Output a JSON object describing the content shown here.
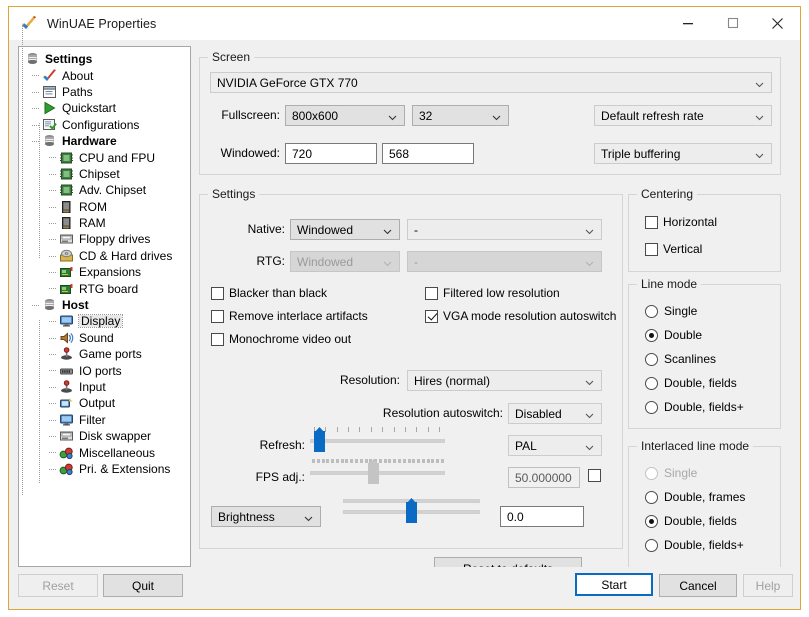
{
  "window": {
    "title": "WinUAE Properties",
    "icon": "checkmark-icon",
    "minimize": "─",
    "maximize": "□",
    "close": "✕",
    "accent_border": "#e0a53a"
  },
  "sidebar": {
    "items": [
      {
        "label": "Settings",
        "level": 0,
        "bold": true,
        "icon": "settings-icon",
        "selected": false
      },
      {
        "label": "About",
        "level": 1,
        "bold": false,
        "icon": "about-icon",
        "selected": false
      },
      {
        "label": "Paths",
        "level": 1,
        "bold": false,
        "icon": "paths-icon",
        "selected": false
      },
      {
        "label": "Quickstart",
        "level": 1,
        "bold": false,
        "icon": "quickstart-icon",
        "selected": false
      },
      {
        "label": "Configurations",
        "level": 1,
        "bold": false,
        "icon": "configurations-icon",
        "selected": false
      },
      {
        "label": "Hardware",
        "level": 1,
        "bold": true,
        "icon": "hardware-icon",
        "selected": false
      },
      {
        "label": "CPU and FPU",
        "level": 2,
        "bold": false,
        "icon": "cpu-icon",
        "selected": false
      },
      {
        "label": "Chipset",
        "level": 2,
        "bold": false,
        "icon": "chipset-icon",
        "selected": false
      },
      {
        "label": "Adv. Chipset",
        "level": 2,
        "bold": false,
        "icon": "adv-chipset-icon",
        "selected": false
      },
      {
        "label": "ROM",
        "level": 2,
        "bold": false,
        "icon": "rom-icon",
        "selected": false
      },
      {
        "label": "RAM",
        "level": 2,
        "bold": false,
        "icon": "ram-icon",
        "selected": false
      },
      {
        "label": "Floppy drives",
        "level": 2,
        "bold": false,
        "icon": "floppy-icon",
        "selected": false
      },
      {
        "label": "CD & Hard drives",
        "level": 2,
        "bold": false,
        "icon": "cd-harddrive-icon",
        "selected": false
      },
      {
        "label": "Expansions",
        "level": 2,
        "bold": false,
        "icon": "expansions-icon",
        "selected": false
      },
      {
        "label": "RTG board",
        "level": 2,
        "bold": false,
        "icon": "rtg-board-icon",
        "selected": false
      },
      {
        "label": "Host",
        "level": 1,
        "bold": true,
        "icon": "host-icon",
        "selected": false
      },
      {
        "label": "Display",
        "level": 2,
        "bold": false,
        "icon": "display-icon",
        "selected": true
      },
      {
        "label": "Sound",
        "level": 2,
        "bold": false,
        "icon": "sound-icon",
        "selected": false
      },
      {
        "label": "Game ports",
        "level": 2,
        "bold": false,
        "icon": "game-ports-icon",
        "selected": false
      },
      {
        "label": "IO ports",
        "level": 2,
        "bold": false,
        "icon": "io-ports-icon",
        "selected": false
      },
      {
        "label": "Input",
        "level": 2,
        "bold": false,
        "icon": "input-icon",
        "selected": false
      },
      {
        "label": "Output",
        "level": 2,
        "bold": false,
        "icon": "output-icon",
        "selected": false
      },
      {
        "label": "Filter",
        "level": 2,
        "bold": false,
        "icon": "filter-icon",
        "selected": false
      },
      {
        "label": "Disk swapper",
        "level": 2,
        "bold": false,
        "icon": "disk-swapper-icon",
        "selected": false
      },
      {
        "label": "Miscellaneous",
        "level": 2,
        "bold": false,
        "icon": "miscellaneous-icon",
        "selected": false
      },
      {
        "label": "Pri. & Extensions",
        "level": 2,
        "bold": false,
        "icon": "pri-extensions-icon",
        "selected": false
      }
    ]
  },
  "screen": {
    "caption": "Screen",
    "adapter": "NVIDIA GeForce GTX 770",
    "fullscreen_label": "Fullscreen:",
    "fullscreen_resolution": "800x600",
    "fullscreen_depth": "32",
    "refresh_rate": "Default refresh rate",
    "windowed_label": "Windowed:",
    "windowed_width": "720",
    "windowed_height": "568",
    "buffering": "Triple buffering"
  },
  "settings": {
    "caption": "Settings",
    "native_label": "Native:",
    "native_mode": "Windowed",
    "native_extra": "-",
    "rtg_label": "RTG:",
    "rtg_mode": "Windowed",
    "rtg_extra": "-",
    "checkboxes": [
      {
        "label": "Blacker than black",
        "checked": false
      },
      {
        "label": "Remove interlace artifacts",
        "checked": false
      },
      {
        "label": "Monochrome video out",
        "checked": false
      },
      {
        "label": "Filtered low resolution",
        "checked": false
      },
      {
        "label": "VGA mode resolution autoswitch",
        "checked": true
      }
    ],
    "resolution_label": "Resolution:",
    "resolution_value": "Hires (normal)",
    "autoswitch_label": "Resolution autoswitch:",
    "autoswitch_value": "Disabled",
    "refresh_label": "Refresh:",
    "refresh_slider_percent": 3,
    "video_standard": "PAL",
    "fps_label": "FPS adj.:",
    "fps_slider_percent": 47,
    "fps_value": "50.000000",
    "fps_checked": false,
    "brightness_control": "Brightness",
    "brightness_slider_percent": 50,
    "brightness_value": "0.0",
    "reset_defaults": "Reset to defaults"
  },
  "centering": {
    "caption": "Centering",
    "options": [
      {
        "label": "Horizontal",
        "checked": false
      },
      {
        "label": "Vertical",
        "checked": false
      }
    ]
  },
  "line_mode": {
    "caption": "Line mode",
    "options": [
      {
        "label": "Single",
        "selected": false,
        "disabled": false
      },
      {
        "label": "Double",
        "selected": true,
        "disabled": false
      },
      {
        "label": "Scanlines",
        "selected": false,
        "disabled": false
      },
      {
        "label": "Double, fields",
        "selected": false,
        "disabled": false
      },
      {
        "label": "Double, fields+",
        "selected": false,
        "disabled": false
      }
    ]
  },
  "interlaced_line_mode": {
    "caption": "Interlaced line mode",
    "options": [
      {
        "label": "Single",
        "selected": false,
        "disabled": true
      },
      {
        "label": "Double, frames",
        "selected": false,
        "disabled": false
      },
      {
        "label": "Double, fields",
        "selected": true,
        "disabled": false
      },
      {
        "label": "Double, fields+",
        "selected": false,
        "disabled": false
      }
    ]
  },
  "footer": {
    "reset": "Reset",
    "quit": "Quit",
    "start": "Start",
    "cancel": "Cancel",
    "help": "Help"
  }
}
